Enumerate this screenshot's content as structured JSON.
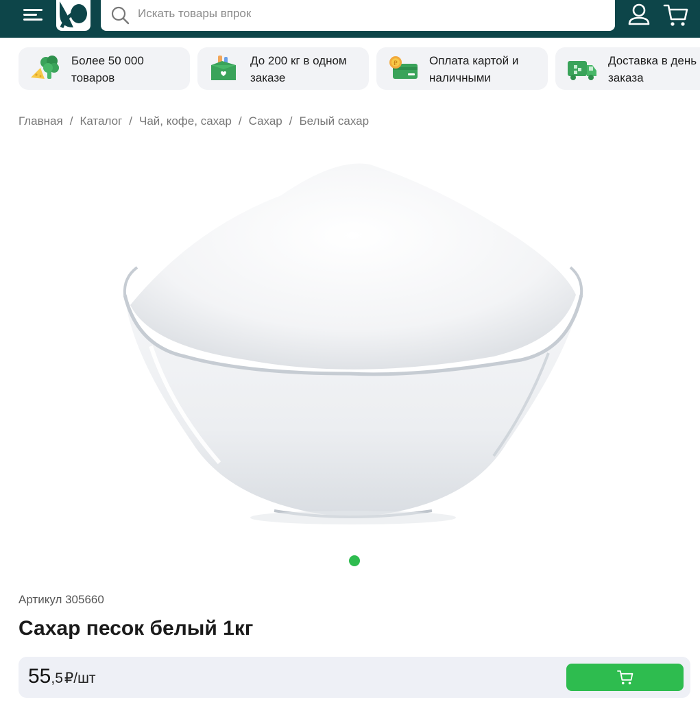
{
  "header": {
    "search_placeholder": "Искать товары впрок",
    "colors": {
      "background": "#0d4549",
      "accent": "#2ebc4f"
    }
  },
  "features": [
    {
      "icon": "broccoli-cheese-icon",
      "text": "Более 50 000\nтоваров"
    },
    {
      "icon": "grocery-box-icon",
      "text": "До 200 кг в одном\nзаказе"
    },
    {
      "icon": "card-coin-icon",
      "text": "Оплата картой и\nналичными"
    },
    {
      "icon": "delivery-truck-icon",
      "text": "Доставка в день\nзаказа"
    }
  ],
  "breadcrumb": {
    "items": [
      "Главная",
      "Каталог",
      "Чай, кофе, сахар",
      "Сахар"
    ],
    "current": "Белый сахар",
    "separator": "/"
  },
  "product": {
    "image": "sugar-bowl-image",
    "article": "Артикул 305660",
    "title": "Сахар песок белый 1кг",
    "price_int": "55",
    "price_frac": ",5",
    "price_unit": "₽/шт"
  }
}
